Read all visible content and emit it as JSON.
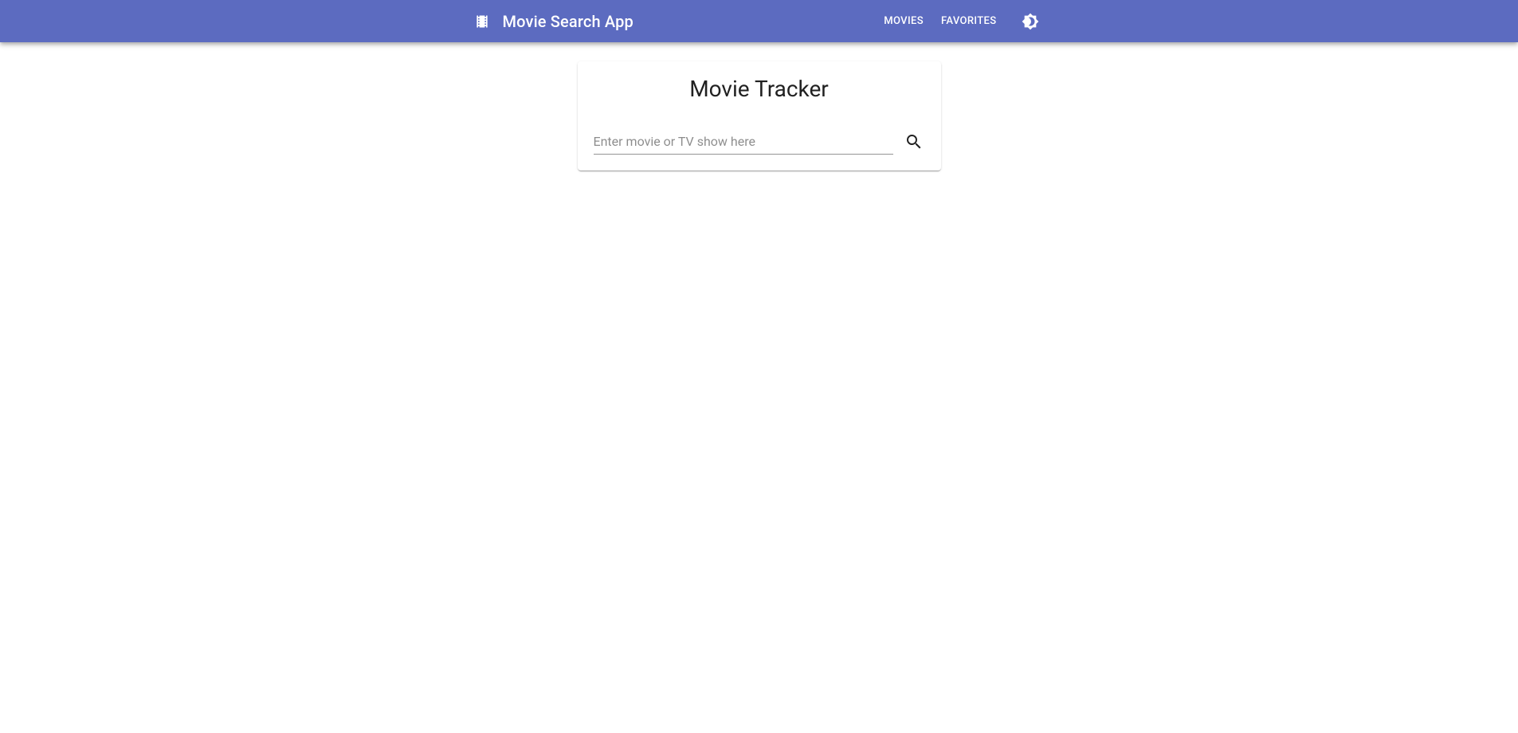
{
  "header": {
    "title": "Movie Search App",
    "nav": {
      "movies": "Movies",
      "favorites": "Favorites"
    }
  },
  "main": {
    "card_title": "Movie Tracker",
    "search": {
      "placeholder": "Enter movie or TV show here",
      "value": ""
    }
  }
}
